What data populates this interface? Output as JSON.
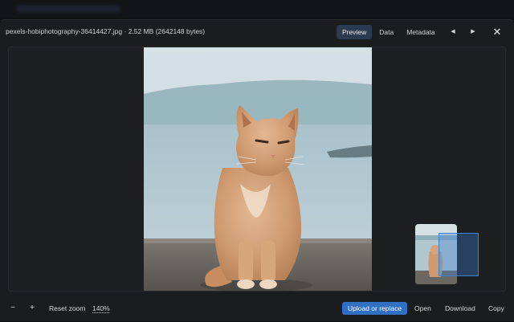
{
  "header": {
    "filename": "pexels-hobiphotography-36414427.jpg",
    "separator": "·",
    "size": "2.52 MB (2642148 bytes)",
    "tabs": [
      {
        "label": "Preview",
        "active": true
      },
      {
        "label": "Data",
        "active": false
      },
      {
        "label": "Metadata",
        "active": false
      }
    ],
    "prev_icon": "◀",
    "next_icon": "▶",
    "close_icon": "✕"
  },
  "viewer": {
    "image_alt": "Orange tabby cat sitting on a stone pier by the sea",
    "minimap": true
  },
  "footer": {
    "zoom_out": "−",
    "zoom_in": "+",
    "reset_zoom": "Reset zoom",
    "zoom_level": "140%",
    "upload_replace": "Upload or replace",
    "open": "Open",
    "download": "Download",
    "copy": "Copy"
  },
  "colors": {
    "accent": "#2f6fc4",
    "tab_active_bg": "#2b3a4e",
    "modal_bg": "#1b1c1e",
    "minimap_frame": "#3b82d6"
  }
}
